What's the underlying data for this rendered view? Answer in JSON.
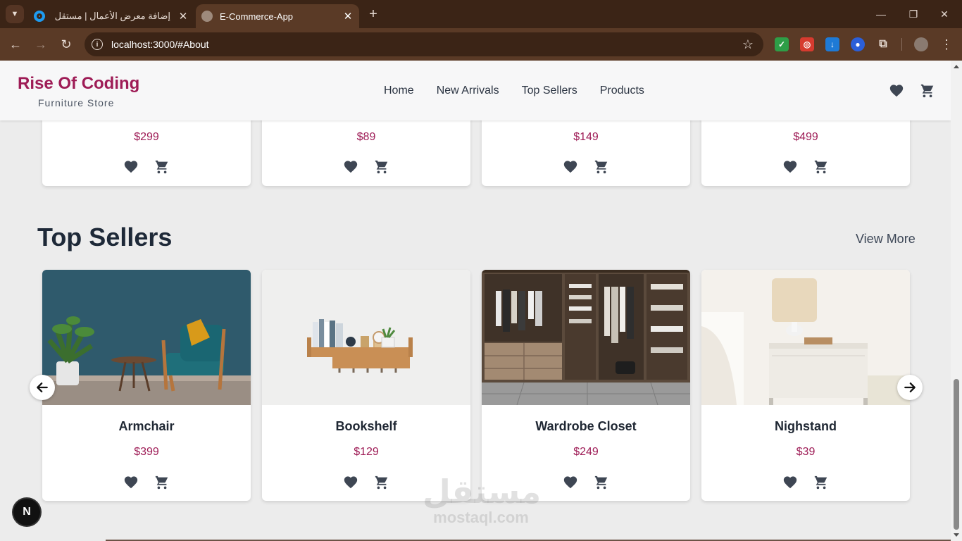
{
  "browser": {
    "tabs": [
      {
        "title": "إضافة معرض الأعمال | مستقل",
        "active": false
      },
      {
        "title": "E-Commerce-App",
        "active": true
      }
    ],
    "close_glyph": "✕",
    "new_tab_glyph": "+",
    "url": "localhost:3000/#About",
    "window_controls": {
      "minimize": "—",
      "restore": "❐",
      "close": "✕"
    }
  },
  "site": {
    "brand": "Rise Of Coding",
    "brand_sub": "Furniture Store",
    "nav": [
      "Home",
      "New Arrivals",
      "Top Sellers",
      "Products"
    ]
  },
  "new_arrivals_prices": [
    "$299",
    "$89",
    "$149",
    "$499"
  ],
  "top_sellers": {
    "title": "Top Sellers",
    "view_more": "View More",
    "products": [
      {
        "name": "Armchair",
        "price": "$399"
      },
      {
        "name": "Bookshelf",
        "price": "$129"
      },
      {
        "name": "Wardrobe Closet",
        "price": "$249"
      },
      {
        "name": "Nighstand",
        "price": "$39"
      }
    ]
  },
  "watermark": {
    "arabic": "مستقل",
    "latin": "mostaql.com"
  },
  "dev_badge": "N",
  "colors": {
    "brand": "#9e1c56",
    "chrome_dark": "#3b2416",
    "chrome_toolbar": "#5a3a26",
    "icon": "#3e4653"
  }
}
